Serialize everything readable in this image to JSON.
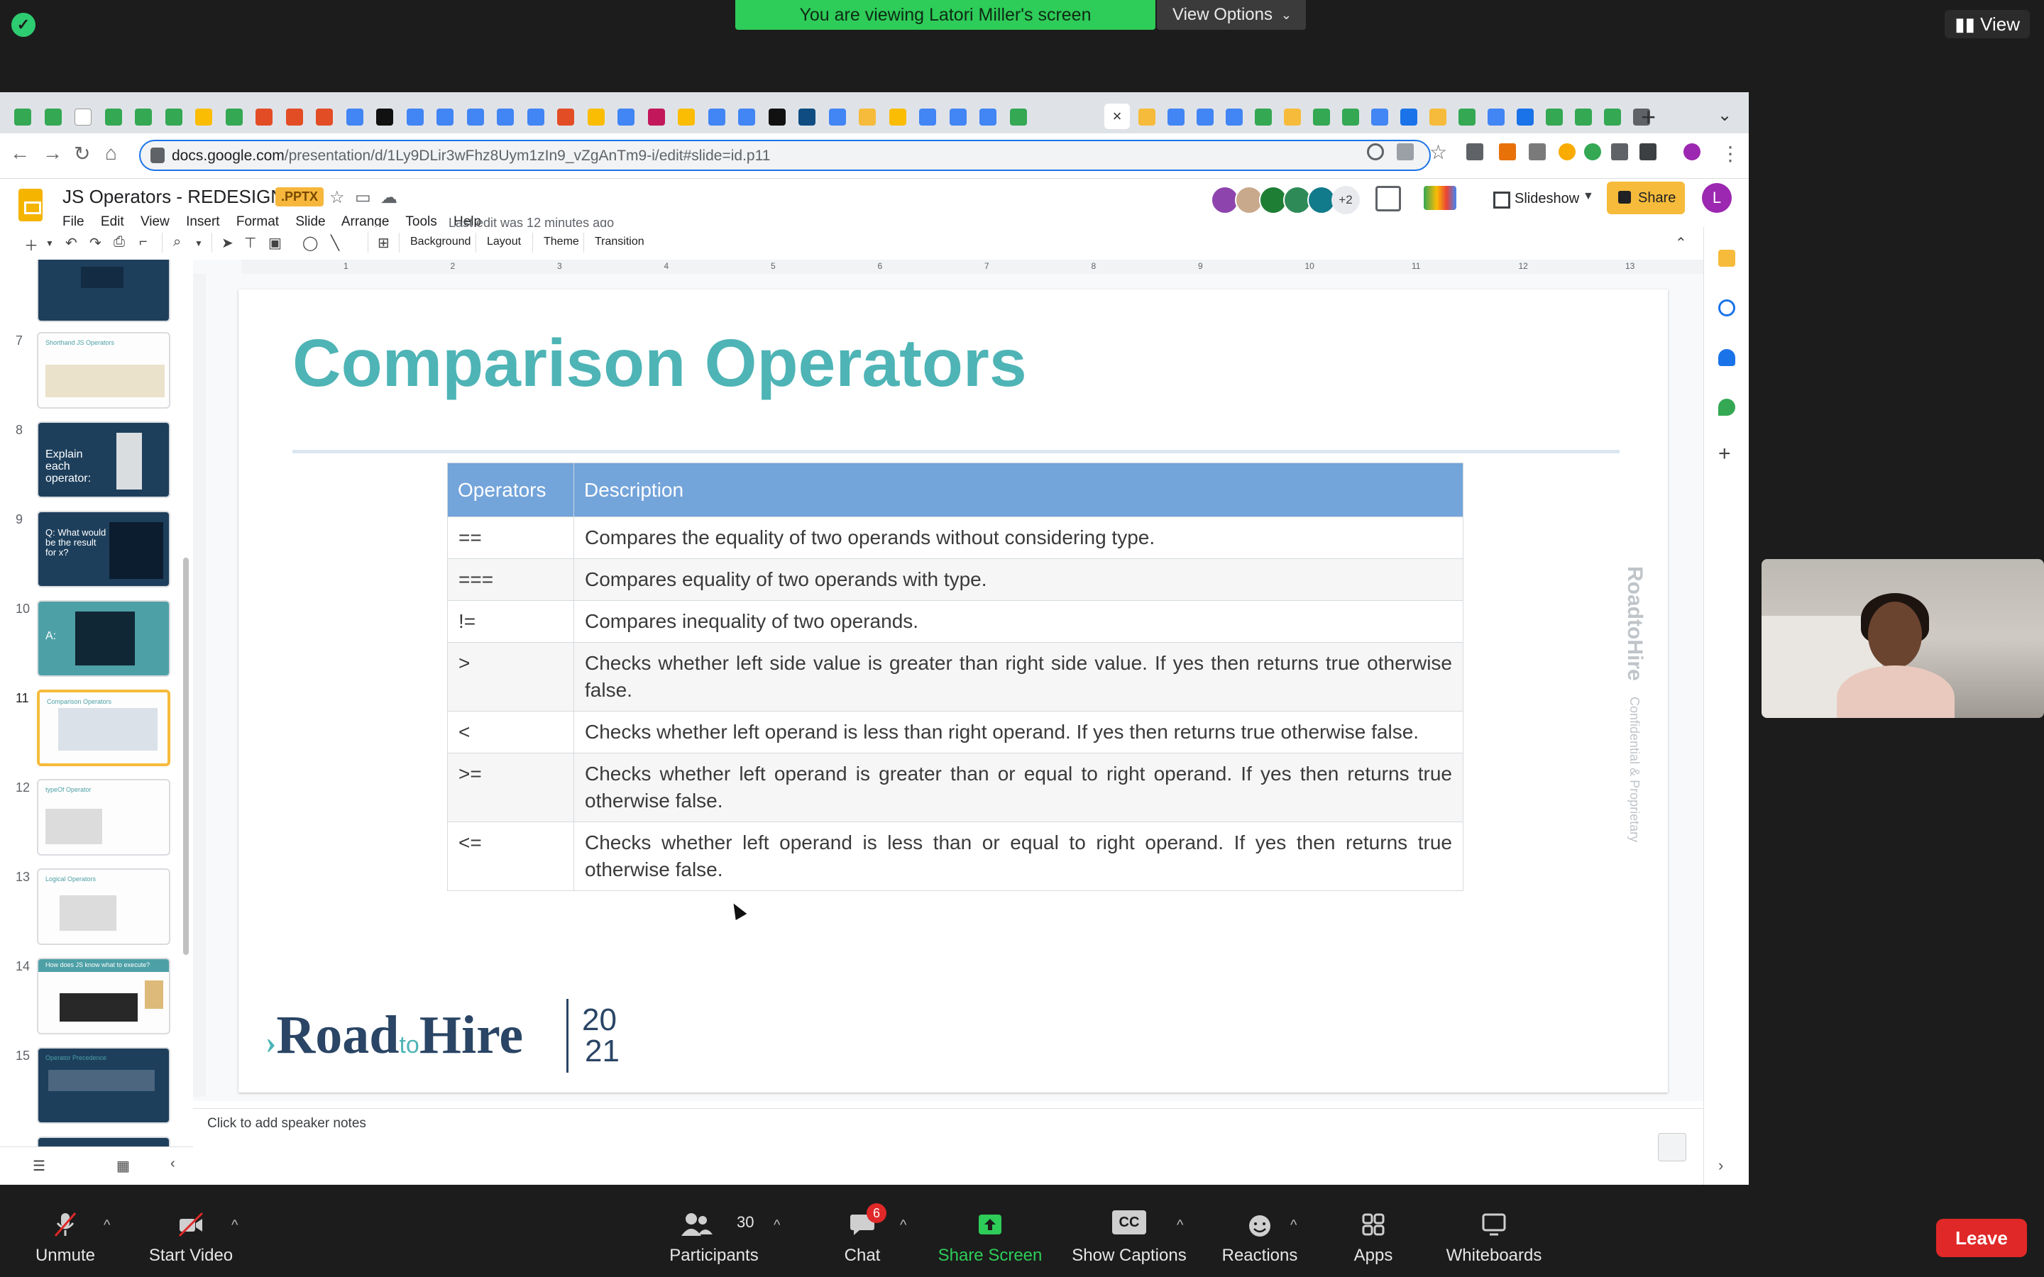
{
  "zoom": {
    "viewing_banner": "You are viewing Latori Miller's screen",
    "view_options": "View Options",
    "view_top_right": "View",
    "bottom": {
      "unmute": "Unmute",
      "start_video": "Start Video",
      "participants": "Participants",
      "participants_count": "30",
      "chat": "Chat",
      "chat_badge": "6",
      "share_screen": "Share Screen",
      "show_captions": "Show Captions",
      "captions_icon": "CC",
      "reactions": "Reactions",
      "apps": "Apps",
      "whiteboards": "Whiteboards",
      "leave": "Leave"
    }
  },
  "browser": {
    "url_host": "docs.google.com",
    "url_path": "/presentation/d/1Ly9DLir3wFhz8Uym1zIn9_vZgAnTm9-i/edit#slide=id.p11"
  },
  "slides_app": {
    "doc_title": "JS Operators - REDESIGNED",
    "badge": ".PPTX",
    "menu": [
      "File",
      "Edit",
      "View",
      "Insert",
      "Format",
      "Slide",
      "Arrange",
      "Tools",
      "Help"
    ],
    "last_edit": "Last edit was 12 minutes ago",
    "avatar_more": "+2",
    "slideshow": "Slideshow",
    "share": "Share",
    "user_initial": "L",
    "toolbar": {
      "background": "Background",
      "layout": "Layout",
      "theme": "Theme",
      "transition": "Transition"
    },
    "ruler_numbers": [
      "1",
      "2",
      "3",
      "4",
      "5",
      "6",
      "7",
      "8",
      "9",
      "10",
      "11",
      "12",
      "13"
    ],
    "speaker_notes": "Click to add speaker notes",
    "thumbnails": [
      {
        "num": "7",
        "title": "Shorthand JS Operators"
      },
      {
        "num": "8",
        "title": "Explain each operator:"
      },
      {
        "num": "9",
        "title": "Q: What would be the result for x?"
      },
      {
        "num": "10",
        "title": "A:"
      },
      {
        "num": "11",
        "title": "Comparison Operators"
      },
      {
        "num": "12",
        "title": "typeOf Operator"
      },
      {
        "num": "13",
        "title": "Logical Operators"
      },
      {
        "num": "14",
        "title": "How does JS know what to execute?"
      },
      {
        "num": "15",
        "title": "Operator Precedence"
      }
    ]
  },
  "slide": {
    "title": "Comparison Operators",
    "table_headers": [
      "Operators",
      "Description"
    ],
    "rows": [
      {
        "op": "==",
        "desc": "Compares the equality of two operands without considering type."
      },
      {
        "op": "===",
        "desc": "Compares equality of two operands with type."
      },
      {
        "op": "!=",
        "desc": "Compares inequality of two operands."
      },
      {
        "op": ">",
        "desc": "Checks whether left side value is greater than right side value. If yes then returns true otherwise false."
      },
      {
        "op": "<",
        "desc": "Checks whether left operand is less than right operand. If yes then returns true otherwise false."
      },
      {
        "op": ">=",
        "desc": "Checks whether left operand is greater than or equal to right operand. If yes then returns true otherwise false."
      },
      {
        "op": "<=",
        "desc": "Checks whether left operand is less than or equal to right operand. If yes then returns true otherwise false."
      }
    ],
    "logo_road": "Road",
    "logo_to": "to",
    "logo_hire": "Hire",
    "logo_year_top": "20",
    "logo_year_bottom": "21",
    "vertical_brand": "RoadtoHire",
    "vertical_note": "Confidential & Proprietary"
  },
  "colors": {
    "title_teal": "#4eb4b6",
    "header_blue": "#73a4da",
    "brand_navy": "#2a4565",
    "share_yellow": "#f6bb3b",
    "zoom_green": "#2ecc58",
    "leave_red": "#e02828"
  }
}
